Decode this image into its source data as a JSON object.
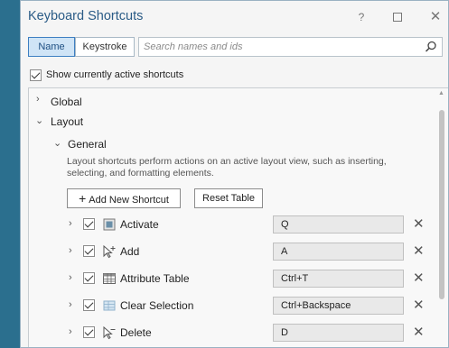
{
  "window": {
    "title": "Keyboard Shortcuts",
    "help_label": "?",
    "close_label": "✕"
  },
  "search": {
    "tabs": [
      {
        "label": "Name",
        "selected": true
      },
      {
        "label": "Keystroke",
        "selected": false
      }
    ],
    "placeholder": "Search names and ids",
    "value": ""
  },
  "options": {
    "show_active_label": "Show currently active shortcuts",
    "show_active_checked": true
  },
  "tree": {
    "global_label": "Global",
    "layout_label": "Layout",
    "general_label": "General",
    "general_description": "Layout shortcuts perform actions on an active layout view, such as inserting, selecting, and formatting elements.",
    "add_button_label": "Add New Shortcut",
    "reset_button_label": "Reset Table",
    "shortcuts": [
      {
        "name": "Activate",
        "keys": "Q",
        "icon": "activate-icon",
        "checked": true
      },
      {
        "name": "Add",
        "keys": "A",
        "icon": "add-cursor-icon",
        "checked": true
      },
      {
        "name": "Attribute Table",
        "keys": "Ctrl+T",
        "icon": "attribute-table-icon",
        "checked": true
      },
      {
        "name": "Clear Selection",
        "keys": "Ctrl+Backspace",
        "icon": "clear-selection-icon",
        "checked": true
      },
      {
        "name": "Delete",
        "keys": "D",
        "icon": "delete-cursor-icon",
        "checked": true
      }
    ]
  },
  "colors": {
    "accent": "#2a5b86",
    "selected_tab_bg": "#cfe4f6",
    "background": "#2b6f8e"
  }
}
